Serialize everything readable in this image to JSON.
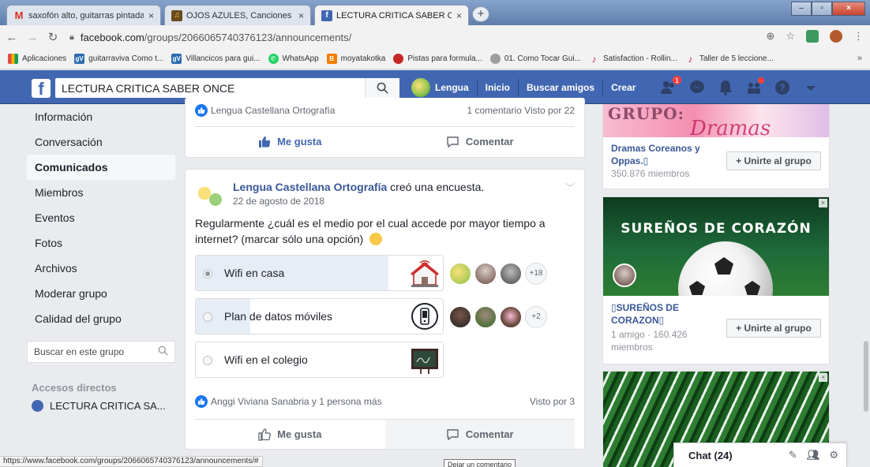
{
  "browser": {
    "tabs": [
      {
        "title": "saxofón alto, guitarras pintadas y",
        "icon": "gmail-icon",
        "active": false
      },
      {
        "title": "OJOS AZULES, Canciones Popula",
        "icon": "song-icon",
        "active": false
      },
      {
        "title": "LECTURA CRITICA SABER ONCE",
        "icon": "facebook-icon",
        "active": true
      }
    ],
    "url_domain": "facebook.com",
    "url_path": "/groups/2066065740376123/announcements/",
    "bookmarks": [
      {
        "label": "Aplicaciones",
        "color": "#e04a3f"
      },
      {
        "label": "guitarraviva Como t...",
        "color": "#2b6cb0",
        "glyph": "gV"
      },
      {
        "label": "Villancicos para gui...",
        "color": "#2b6cb0",
        "glyph": "gV"
      },
      {
        "label": "WhatsApp",
        "color": "#25d366",
        "glyph": "✆"
      },
      {
        "label": "moyatakotka",
        "color": "#f57d00",
        "glyph": "B"
      },
      {
        "label": "Pistas para formula...",
        "color": "#c62828",
        "glyph": "●"
      },
      {
        "label": "01. Como Tocar Gui...",
        "color": "#777777",
        "glyph": "☺"
      },
      {
        "label": "Satisfaction - Rollin...",
        "color": "#d81b60",
        "glyph": "♪"
      },
      {
        "label": "Taller de 5 leccione...",
        "color": "#d81b60",
        "glyph": "♪"
      }
    ],
    "bookmarks_more": "»",
    "status_url": "https://www.facebook.com/groups/2066065740376123/announcements/#",
    "tooltip": "Dejar un comentario"
  },
  "fb": {
    "brand_color": "#4267b2",
    "search_value": "LECTURA CRITICA SABER ONCE",
    "nav": {
      "profile": "Lengua",
      "home": "Inicio",
      "find_friends": "Buscar amigos",
      "create": "Crear"
    },
    "friend_requests_badge": "1"
  },
  "left_nav": {
    "items": [
      {
        "label": "Información",
        "active": false
      },
      {
        "label": "Conversación",
        "active": false
      },
      {
        "label": "Comunicados",
        "active": true
      },
      {
        "label": "Miembros",
        "active": false
      },
      {
        "label": "Eventos",
        "active": false
      },
      {
        "label": "Fotos",
        "active": false
      },
      {
        "label": "Archivos",
        "active": false
      },
      {
        "label": "Moderar grupo",
        "active": false
      },
      {
        "label": "Calidad del grupo",
        "active": false
      }
    ],
    "search_placeholder": "Buscar en este grupo",
    "shortcuts_title": "Accesos directos",
    "shortcut_item": "LECTURA CRITICA SA..."
  },
  "post1": {
    "reactions": "Lengua Castellana Ortografía",
    "stats": "1 comentario  Visto por 22",
    "like": "Me gusta",
    "comment": "Comentar"
  },
  "post2": {
    "author": "Lengua Castellana Ortografía",
    "action": " creó una encuesta.",
    "date": "22 de agosto de 2018",
    "text": "Regularmente ¿cuál es el medio por el cual accede por mayor tiempo a internet? (marcar sólo una opción)",
    "options": [
      {
        "label": "Wifi en casa",
        "selected": true,
        "fill_fraction": 0.78,
        "more_voters": "+18",
        "icon": "house-wifi-icon"
      },
      {
        "label": "Plan de datos móviles",
        "selected": false,
        "fill_fraction": 0.22,
        "more_voters": "+2",
        "icon": "mobile-phone-icon"
      },
      {
        "label": "Wifi en el colegio",
        "selected": false,
        "fill_fraction": 0.0,
        "more_voters": "",
        "icon": "school-board-icon"
      }
    ],
    "reactions": "Anggi Viviana Sanabria y 1 persona más",
    "seen": "Visto por 3",
    "like": "Me gusta",
    "comment": "Comentar"
  },
  "right_col": {
    "group1": {
      "banner": "GRUPO: Dramas Coreanos",
      "name": "Dramas Coreanos y Oppas.▯",
      "members": "350.876 miembros",
      "join": "+ Unirte al grupo"
    },
    "group2": {
      "banner": "SUREÑOS DE CORAZÓN",
      "name": "▯SUREÑOS DE CORAZON▯",
      "members": "1 amigo · 160.426 miembros",
      "join": "+ Unirte al grupo"
    },
    "close": "×"
  },
  "chat": {
    "label": "Chat (24)"
  }
}
